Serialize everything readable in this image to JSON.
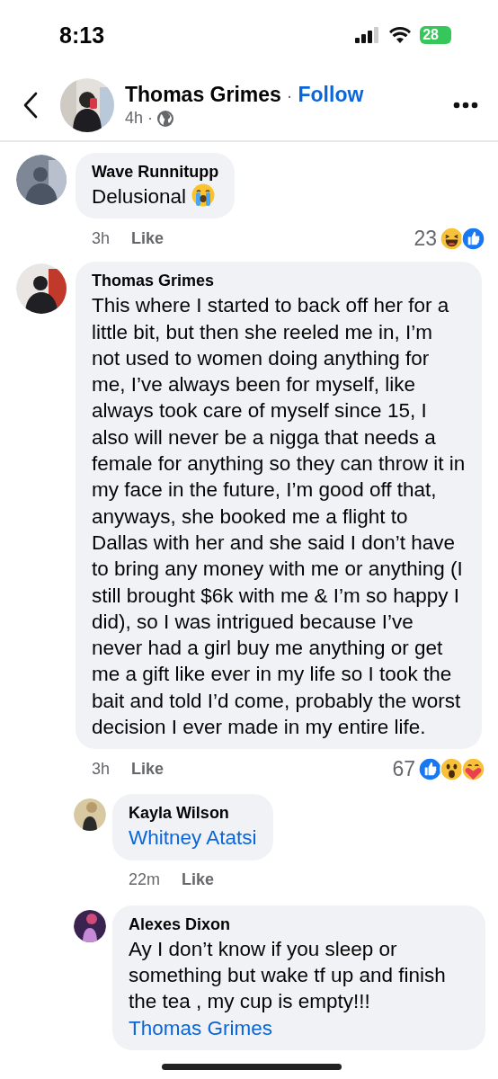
{
  "status_bar": {
    "time": "8:13",
    "battery": "28"
  },
  "header": {
    "author": "Thomas Grimes",
    "separator": "·",
    "follow": "Follow",
    "age": "4h",
    "dot": "·"
  },
  "comments": [
    {
      "author": "Wave Runnitupp",
      "parts": [
        {
          "kind": "text",
          "text": "Delusional"
        },
        {
          "kind": "crying_emoji"
        }
      ],
      "time": "3h",
      "like": "Like",
      "count": "23",
      "reactions": [
        {
          "kind": "haha"
        },
        {
          "kind": "like"
        }
      ]
    },
    {
      "author": "Thomas Grimes",
      "parts": [
        {
          "kind": "text",
          "text": "This where I started to back off her for a little bit, but then she reeled me in, I’m not used to women doing anything for me, I’ve always been for myself, like always took care of myself since 15, I also will never be a nigga that needs a female for anything so they can throw it in my face in the future, I’m good off that, anyways, she booked me a flight to Dallas with her and she said I don’t have to bring any money with me or anything (I still brought $6k with me & I’m so happy I did), so I was intrigued because I’ve never had a girl buy me anything or get me a gift like ever in my life so I took the bait and told I’d come, probably the worst decision I ever made in my entire life."
        }
      ],
      "time": "3h",
      "like": "Like",
      "count": "67",
      "reactions": [
        {
          "kind": "like"
        },
        {
          "kind": "wow"
        },
        {
          "kind": "care"
        }
      ],
      "children": [
        {
          "author": "Kayla Wilson",
          "parts": [
            {
              "kind": "mention",
              "text": "Whitney Atatsi"
            }
          ],
          "time": "22m",
          "like": "Like"
        },
        {
          "author": "Alexes Dixon",
          "parts": [
            {
              "kind": "text",
              "text": "Ay I don’t know if you sleep or something but wake tf up and finish the tea , my cup is empty!!!"
            },
            {
              "kind": "mention",
              "text": "Thomas Grimes"
            }
          ]
        }
      ]
    }
  ]
}
